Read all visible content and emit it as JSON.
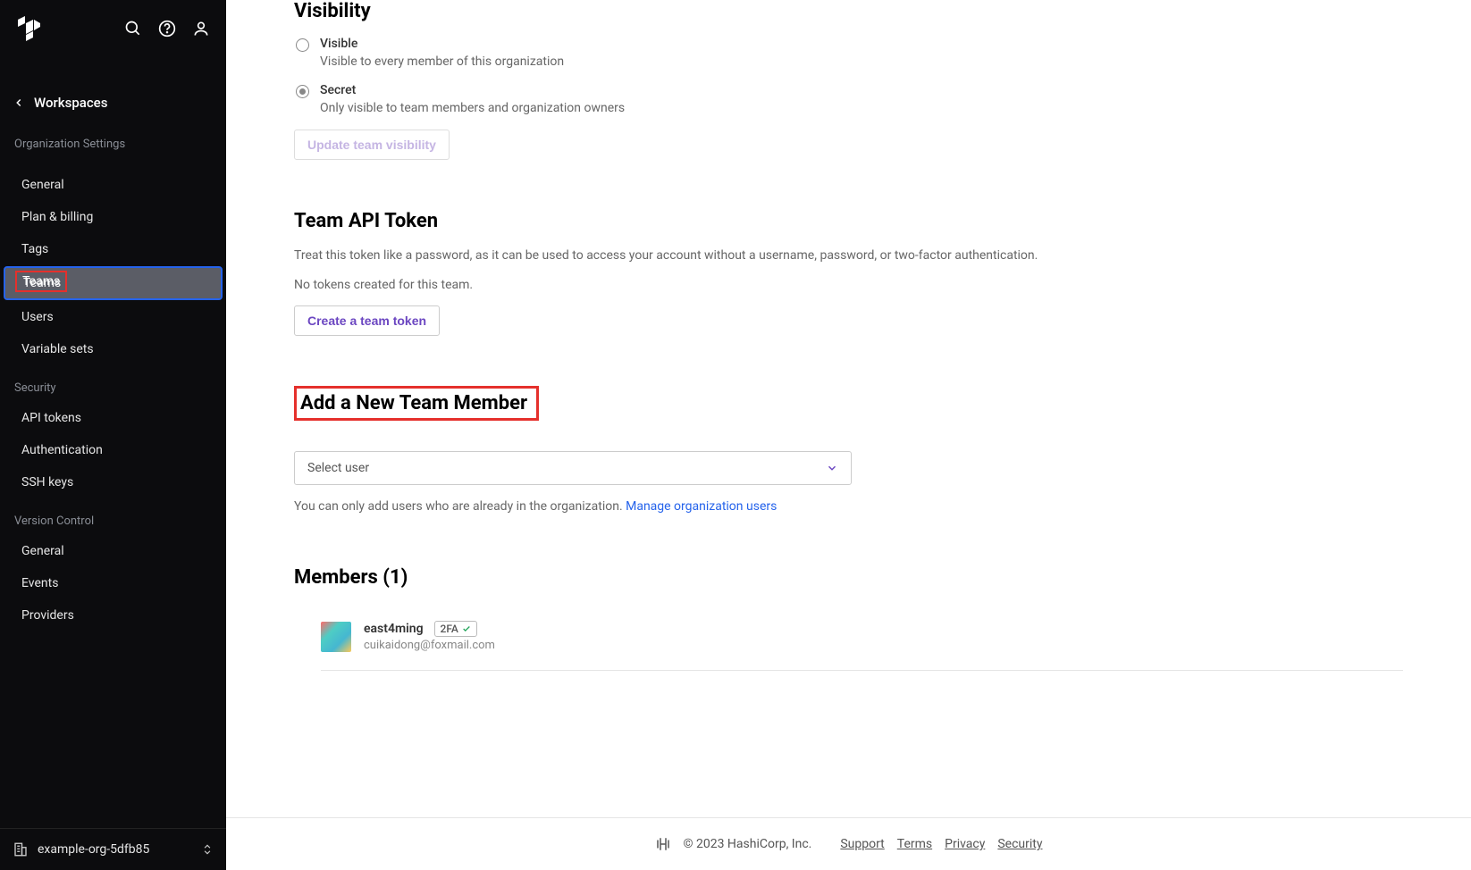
{
  "sidebar": {
    "workspaces_label": "Workspaces",
    "org_settings_label": "Organization Settings",
    "nav1": [
      {
        "label": "General"
      },
      {
        "label": "Plan & billing"
      },
      {
        "label": "Tags"
      },
      {
        "label": "Teams"
      },
      {
        "label": "Users"
      },
      {
        "label": "Variable sets"
      }
    ],
    "security_label": "Security",
    "nav2": [
      {
        "label": "API tokens"
      },
      {
        "label": "Authentication"
      },
      {
        "label": "SSH keys"
      }
    ],
    "vc_label": "Version Control",
    "nav3": [
      {
        "label": "General"
      },
      {
        "label": "Events"
      },
      {
        "label": "Providers"
      }
    ],
    "org_name": "example-org-5dfb85"
  },
  "visibility": {
    "heading": "Visibility",
    "opt1_title": "Visible",
    "opt1_desc": "Visible to every member of this organization",
    "opt2_title": "Secret",
    "opt2_desc": "Only visible to team members and organization owners",
    "update_btn": "Update team visibility"
  },
  "api_token": {
    "heading": "Team API Token",
    "desc": "Treat this token like a password, as it can be used to access your account without a username, password, or two-factor authentication.",
    "none": "No tokens created for this team.",
    "create_btn": "Create a team token"
  },
  "add_member": {
    "heading": "Add a New Team Member",
    "select_placeholder": "Select user",
    "desc_prefix": "You can only add users who are already in the organization. ",
    "manage_link": "Manage organization users"
  },
  "members": {
    "heading": "Members (1)",
    "items": [
      {
        "name": "east4ming",
        "badge": "2FA",
        "email": "cuikaidong@foxmail.com"
      }
    ]
  },
  "footer": {
    "copyright": "© 2023 HashiCorp, Inc.",
    "links": [
      "Support",
      "Terms",
      "Privacy",
      "Security"
    ]
  }
}
